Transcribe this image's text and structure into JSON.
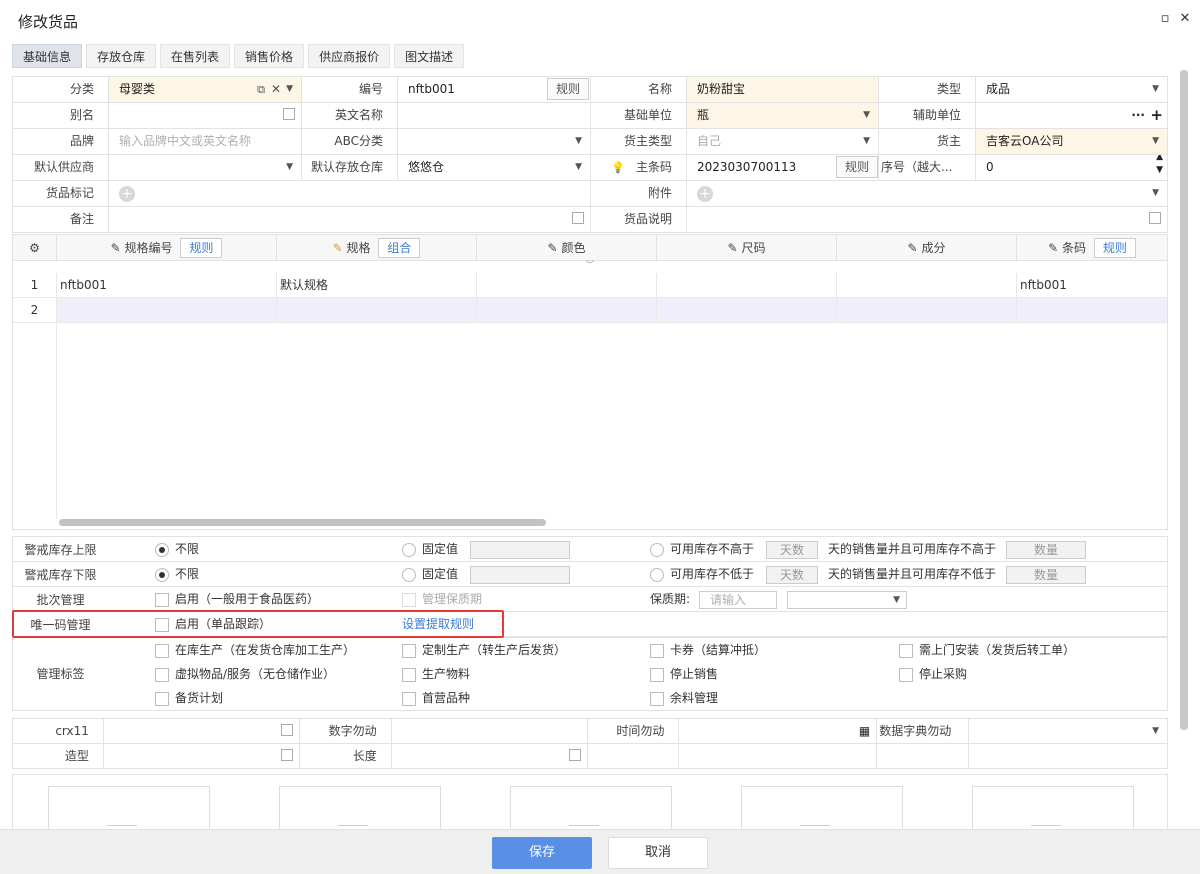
{
  "window": {
    "title": "修改货品",
    "maximize_glyph": "▫",
    "close_glyph": "✕"
  },
  "tabs": [
    "基础信息",
    "存放仓库",
    "在售列表",
    "销售价格",
    "供应商报价",
    "图文描述"
  ],
  "form": {
    "category": {
      "label": "分类",
      "value": "母婴类"
    },
    "code": {
      "label": "编号",
      "value": "nftb001",
      "rule_btn": "规则"
    },
    "name": {
      "label": "名称",
      "value": "奶粉甜宝"
    },
    "type": {
      "label": "类型",
      "value": "成品"
    },
    "alias": {
      "label": "别名",
      "value": ""
    },
    "english_name": {
      "label": "英文名称",
      "value": ""
    },
    "base_unit": {
      "label": "基础单位",
      "value": "瓶"
    },
    "aux_unit": {
      "label": "辅助单位",
      "value": ""
    },
    "brand": {
      "label": "品牌",
      "placeholder": "输入品牌中文或英文名称"
    },
    "abc": {
      "label": "ABC分类",
      "value": ""
    },
    "owner_type": {
      "label": "货主类型",
      "value": "自己"
    },
    "owner": {
      "label": "货主",
      "value": "吉客云OA公司"
    },
    "default_supplier": {
      "label": "默认供应商",
      "value": ""
    },
    "default_warehouse": {
      "label": "默认存放仓库",
      "value": "悠悠仓"
    },
    "barcode": {
      "label": "主条码",
      "value": "2023030700113",
      "rule_btn": "规则"
    },
    "seq": {
      "label": "序号（越大...",
      "value": "0"
    },
    "goods_tag": {
      "label": "货品标记"
    },
    "attachment": {
      "label": "附件"
    },
    "remark": {
      "label": "备注",
      "value": ""
    },
    "goods_desc": {
      "label": "货品说明",
      "value": ""
    }
  },
  "spec_table": {
    "headers": {
      "spec_code": "规格编号",
      "spec_code_btn": "规则",
      "spec": "规格",
      "spec_btn": "组合",
      "color": "颜色",
      "size": "尺码",
      "component": "成分",
      "barcode": "条码",
      "barcode_btn": "规则"
    },
    "rows": [
      {
        "num": "1",
        "spec_code": "nftb001",
        "spec": "默认规格",
        "color": "",
        "size": "",
        "component": "",
        "barcode": "nftb001"
      },
      {
        "num": "2",
        "spec_code": "",
        "spec": "",
        "color": "",
        "size": "",
        "component": "",
        "barcode": ""
      }
    ]
  },
  "management": {
    "upper": {
      "label": "警戒库存上限",
      "opt_unlimited": "不限",
      "opt_fixed": "固定值",
      "opt_available": "可用库存不高于",
      "days_placeholder": "天数",
      "mid_text": "天的销售量并且可用库存不高于",
      "qty_placeholder": "数量"
    },
    "lower": {
      "label": "警戒库存下限",
      "opt_unlimited": "不限",
      "opt_fixed": "固定值",
      "opt_available": "可用库存不低于",
      "days_placeholder": "天数",
      "mid_text": "天的销售量并且可用库存不低于",
      "qty_placeholder": "数量"
    },
    "batch": {
      "label": "批次管理",
      "enable": "启用（一般用于食品医药）",
      "shelf_life_mgmt": "管理保质期",
      "shelf_life_label": "保质期:",
      "shelf_life_placeholder": "请输入"
    },
    "unique": {
      "label": "唯一码管理",
      "enable": "启用（单品跟踪）",
      "link": "设置提取规则"
    },
    "tags": {
      "label": "管理标签",
      "items": [
        "在库生产（在发货仓库加工生产）",
        "定制生产（转生产后发货）",
        "卡券（结算冲抵）",
        "需上门安装（发货后转工单）",
        "虚拟物品/服务（无仓储作业）",
        "生产物料",
        "停止销售",
        "停止采购",
        "备货计划",
        "首营品种",
        "余料管理"
      ]
    }
  },
  "custom_fields": {
    "crx11": "crx11",
    "number_field": "数字勿动",
    "time_field": "时间勿动",
    "dict_field": "数据字典勿动",
    "shape": "造型",
    "length": "长度"
  },
  "footer": {
    "save": "保存",
    "cancel": "取消"
  },
  "colors": {
    "primary": "#5a8fe6",
    "highlight": "#e53935",
    "link": "#3a7bd5",
    "input_yellow": "#fdf5e6"
  }
}
